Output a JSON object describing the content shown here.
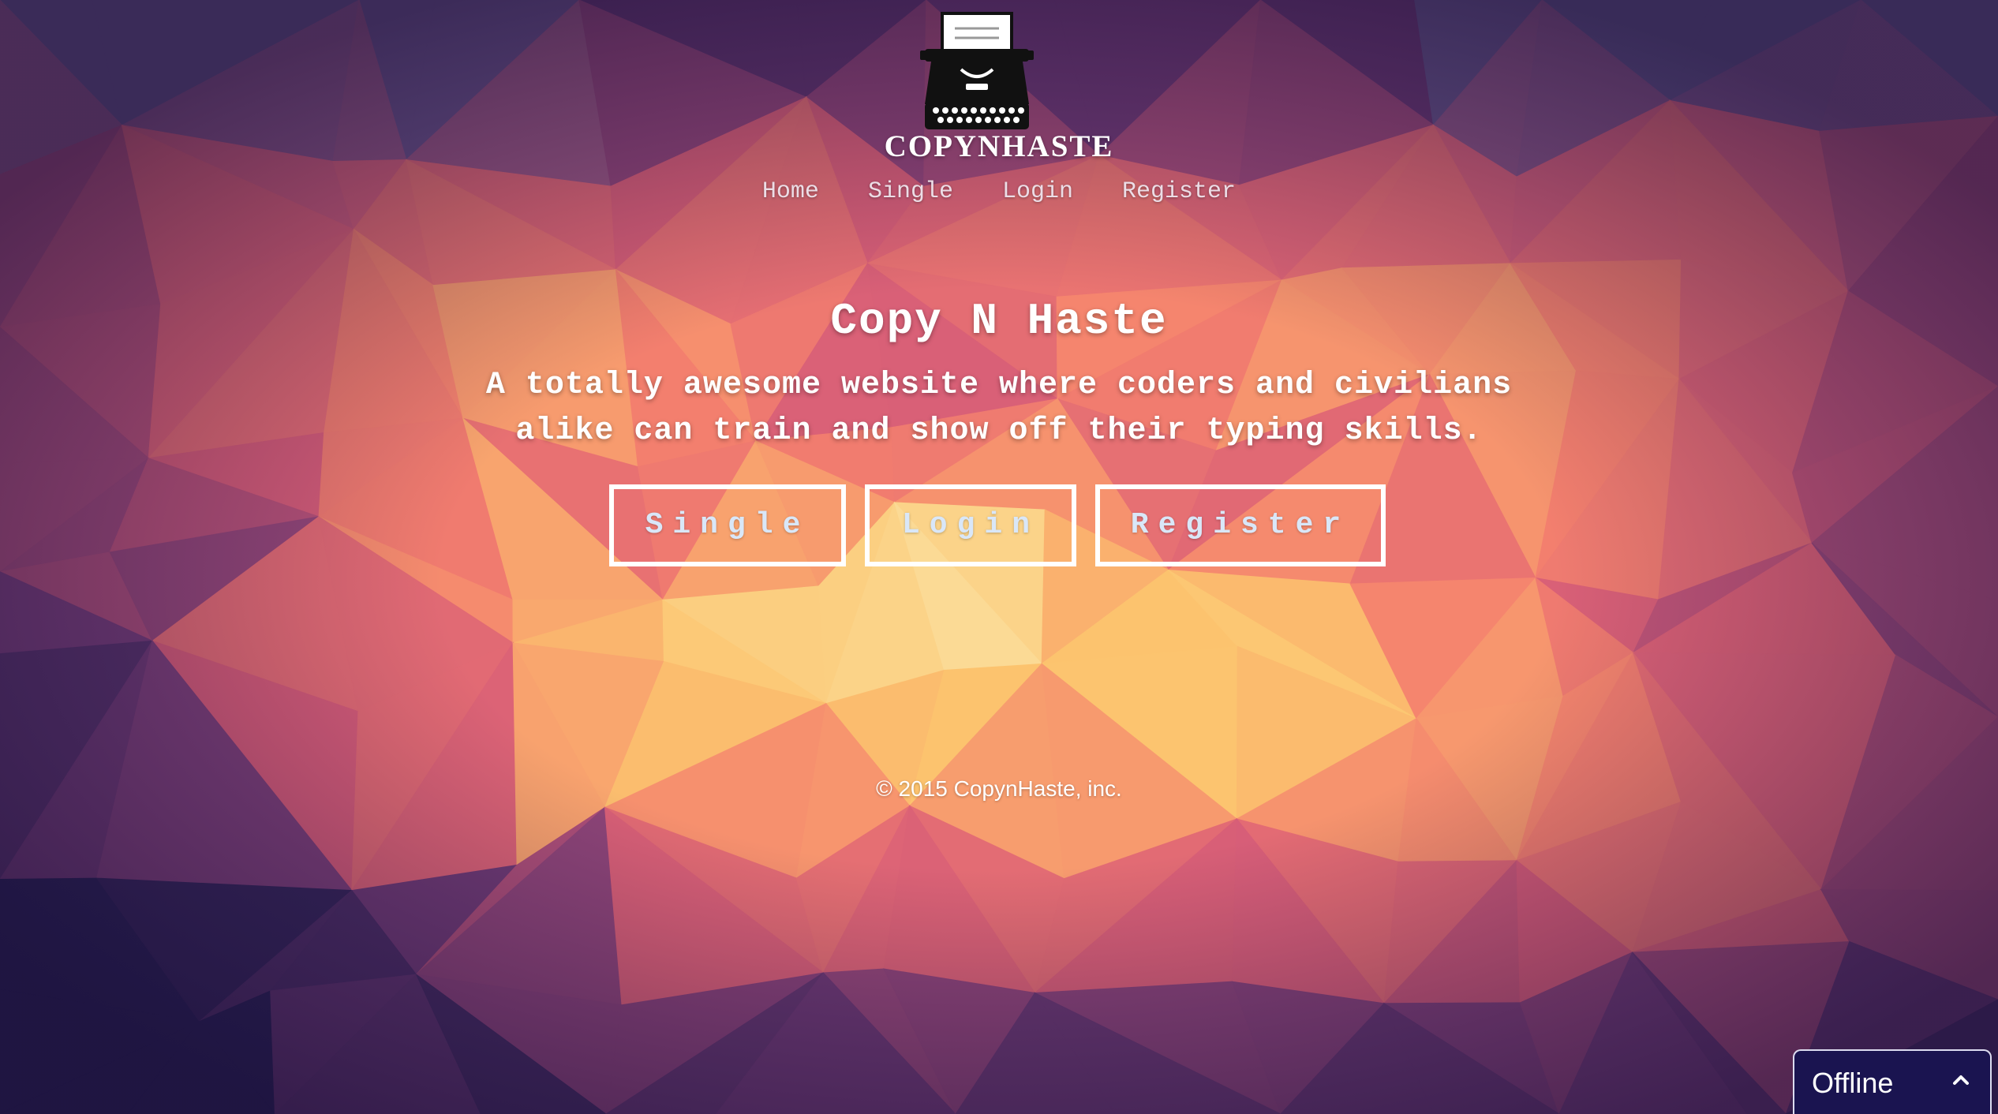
{
  "header": {
    "brand": "COPYNHASTE",
    "logo_icon": "typewriter-icon"
  },
  "nav": {
    "items": [
      "Home",
      "Single",
      "Login",
      "Register"
    ]
  },
  "hero": {
    "title": "Copy N Haste",
    "subtitle": "A totally awesome website where coders and civilians alike can train and show off their typing skills."
  },
  "buttons": {
    "single": "Single",
    "login": "Login",
    "register": "Register"
  },
  "footer": {
    "copyright": "© 2015 CopynHaste, inc."
  },
  "chat_widget": {
    "status": "Offline",
    "icon": "chevron-up-icon"
  },
  "theme": {
    "text": "#ffffff",
    "button_text": "#d9e7f8",
    "chat_bg": "#1a1450"
  }
}
